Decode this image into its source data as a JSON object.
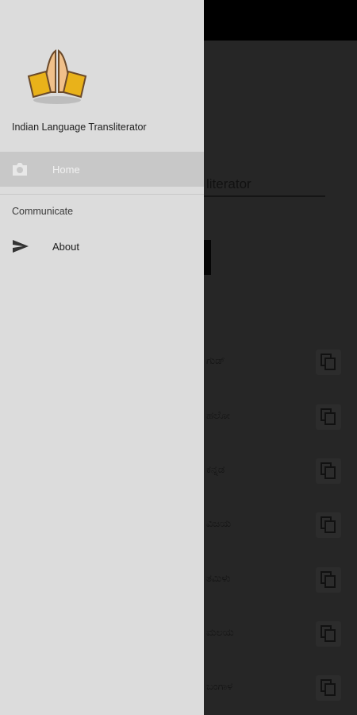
{
  "drawer": {
    "app_name": "Indian Language Transliterator",
    "logo_icon": "praying-hands-icon",
    "items": [
      {
        "label": "Home",
        "icon": "camera-icon",
        "selected": true
      },
      {
        "section": "Communicate"
      },
      {
        "label": "About",
        "icon": "send-icon"
      }
    ]
  },
  "background": {
    "title_fragment": "literator",
    "rows": [
      {
        "text": "ಗುಡ್",
        "copy_icon": "copy-icon"
      },
      {
        "text": "ಹಲೋ",
        "copy_icon": "copy-icon"
      },
      {
        "text": "ಕನ್ನಡ",
        "copy_icon": "copy-icon"
      },
      {
        "text": "ವಿಜಯ",
        "copy_icon": "copy-icon"
      },
      {
        "text": "ತಮಿಳು",
        "copy_icon": "copy-icon"
      },
      {
        "text": "ಮಲಯ",
        "copy_icon": "copy-icon"
      },
      {
        "text": "ಬಂಗಾಳ",
        "copy_icon": "copy-icon"
      }
    ]
  },
  "colors": {
    "scrim": "#262626",
    "drawer": "#dcdcdc",
    "selected_row": "#c8c8c8"
  }
}
